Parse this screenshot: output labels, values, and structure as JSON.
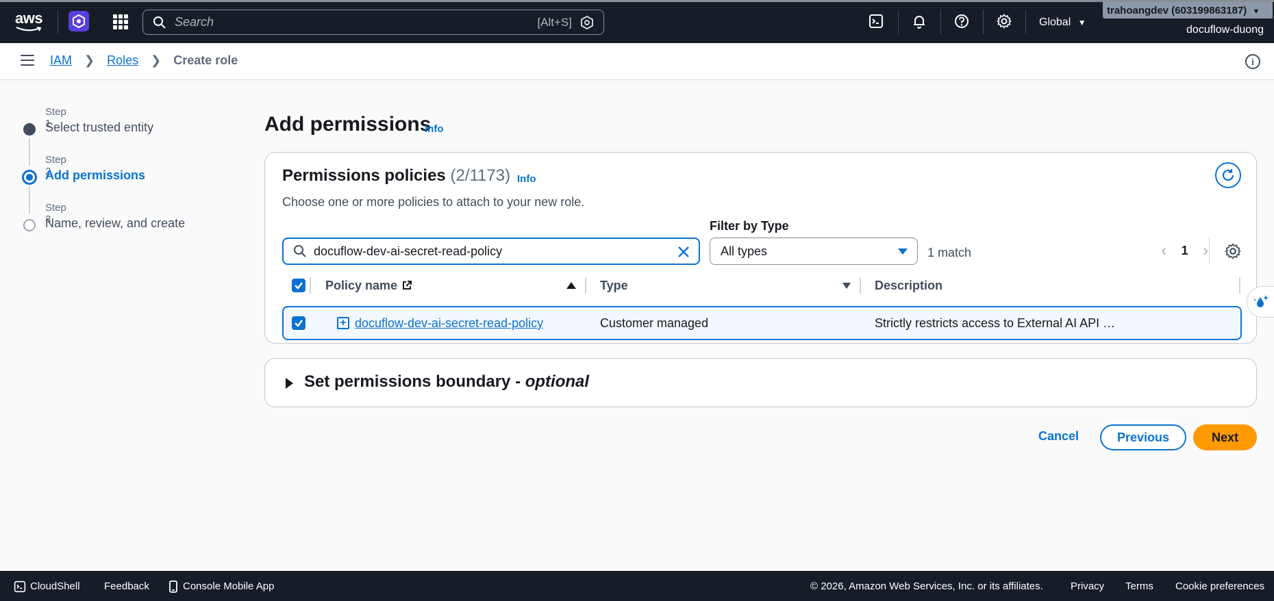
{
  "topnav": {
    "logo_text": "aws",
    "search_placeholder": "Search",
    "search_shortcut": "[Alt+S]",
    "region": "Global",
    "account_badge": "trahoangdev (603199863187)",
    "account_name": "docuflow-duong"
  },
  "breadcrumb": {
    "items": [
      "IAM",
      "Roles"
    ],
    "current": "Create role"
  },
  "stepper": [
    {
      "label": "Step 1",
      "title": "Select trusted entity",
      "state": "completed"
    },
    {
      "label": "Step 2",
      "title": "Add permissions",
      "state": "current"
    },
    {
      "label": "Step 3",
      "title": "Name, review, and create",
      "state": "upcoming"
    }
  ],
  "page": {
    "title": "Add permissions",
    "info": "Info"
  },
  "policies": {
    "title": "Permissions policies",
    "count": "(2/1173)",
    "info": "Info",
    "description": "Choose one or more policies to attach to your new role.",
    "filter_value": "docuflow-dev-ai-secret-read-policy",
    "filter_type_label": "Filter by Type",
    "filter_type_value": "All types",
    "match_text": "1 match",
    "page_number": "1",
    "columns": [
      "Policy name",
      "Type",
      "Description"
    ],
    "rows": [
      {
        "name": "docuflow-dev-ai-secret-read-policy",
        "type": "Customer managed",
        "description": "Strictly restricts access to External AI API …"
      }
    ]
  },
  "boundary": {
    "title": "Set permissions boundary - ",
    "title_optional": "optional"
  },
  "actions": {
    "cancel": "Cancel",
    "previous": "Previous",
    "next": "Next"
  },
  "footer": {
    "cloudshell": "CloudShell",
    "feedback": "Feedback",
    "mobile_app": "Console Mobile App",
    "copyright": "© 2026, Amazon Web Services, Inc. or its affiliates.",
    "privacy": "Privacy",
    "terms": "Terms",
    "cookie": "Cookie preferences"
  },
  "colors": {
    "nav_bg": "#161d26",
    "accent": "#0972d3",
    "primary_button": "#ff9900"
  }
}
